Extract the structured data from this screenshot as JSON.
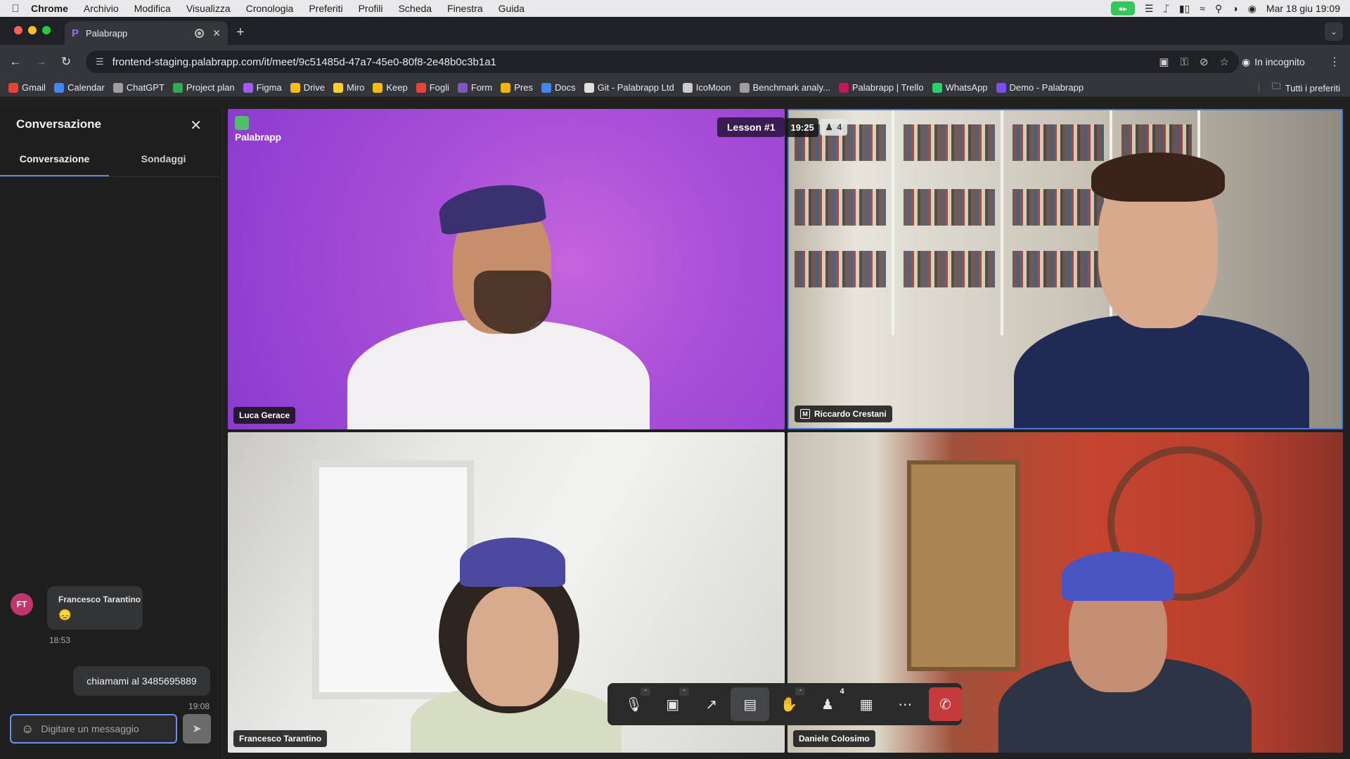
{
  "menubar": {
    "app": "Chrome",
    "items": [
      "Archivio",
      "Modifica",
      "Visualizza",
      "Cronologia",
      "Preferiti",
      "Profili",
      "Scheda",
      "Finestra",
      "Guida"
    ],
    "datetime": "Mar 18 giu 19:09"
  },
  "browser": {
    "tab_title": "Palabrapp",
    "url": "frontend-staging.palabrapp.com/it/meet/9c51485d-47a7-45e0-80f8-2e48b0c3b1a1",
    "incognito_label": "In incognito",
    "bookmarks": [
      {
        "label": "Gmail",
        "color": "#ea4335"
      },
      {
        "label": "Calendar",
        "color": "#4285f4"
      },
      {
        "label": "ChatGPT",
        "color": "#9e9e9e"
      },
      {
        "label": "Project plan",
        "color": "#34a853"
      },
      {
        "label": "Figma",
        "color": "#a259ff"
      },
      {
        "label": "Drive",
        "color": "#fbbc04"
      },
      {
        "label": "Miro",
        "color": "#ffd02f"
      },
      {
        "label": "Keep",
        "color": "#fbbc04"
      },
      {
        "label": "Fogli",
        "color": "#ea4335"
      },
      {
        "label": "Form",
        "color": "#7e57c2"
      },
      {
        "label": "Pres",
        "color": "#f4b400"
      },
      {
        "label": "Docs",
        "color": "#4285f4"
      },
      {
        "label": "Git - Palabrapp Ltd",
        "color": "#e0e0e0"
      },
      {
        "label": "IcoMoon",
        "color": "#cccccc"
      },
      {
        "label": "Benchmark analy...",
        "color": "#9e9e9e"
      },
      {
        "label": "Palabrapp | Trello",
        "color": "#c2185b"
      },
      {
        "label": "WhatsApp",
        "color": "#25d366"
      },
      {
        "label": "Demo - Palabrapp",
        "color": "#7c4dff"
      }
    ],
    "all_bookmarks": "Tutti i preferiti"
  },
  "chat": {
    "title": "Conversazione",
    "tabs": [
      "Conversazione",
      "Sondaggi"
    ],
    "messages": [
      {
        "initials": "FT",
        "sender": "Francesco Tarantino",
        "text": "😞",
        "time": "18:53"
      },
      {
        "text": "chiamami al 3485695889",
        "time": "19:08"
      }
    ],
    "placeholder": "Digitare un messaggio"
  },
  "meeting": {
    "logo": "Palabrapp",
    "lesson": "Lesson #1",
    "timer": "19:25",
    "participants_count": "4",
    "participants": [
      "Luca Gerace",
      "Riccardo Crestani",
      "Francesco Tarantino",
      "Daniele Colosimo"
    ]
  },
  "controls": {
    "participants_badge": "4",
    "hangup_color": "#c53a3a",
    "accent": "#6d8fe8"
  }
}
